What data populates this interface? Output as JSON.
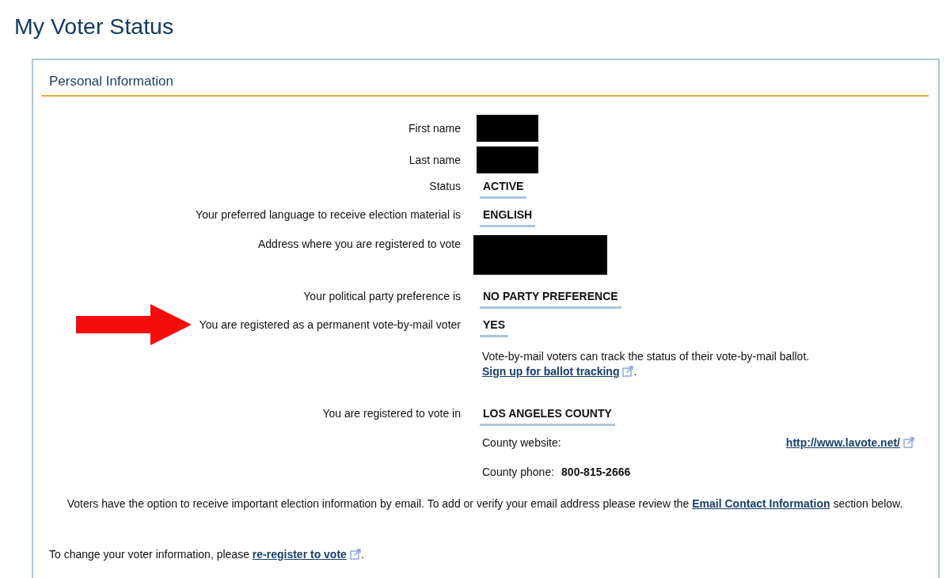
{
  "page_title": "My Voter Status",
  "panel": {
    "title": "Personal Information",
    "rows": [
      {
        "label": "First name",
        "kind": "redacted-name",
        "highlighted": false
      },
      {
        "label": "Last name",
        "kind": "redacted-name",
        "highlighted": false
      },
      {
        "label": "Status",
        "kind": "value",
        "value": "ACTIVE",
        "highlighted": false
      },
      {
        "label": "Your preferred language to receive election material is",
        "kind": "value",
        "value": "ENGLISH",
        "highlighted": false
      },
      {
        "label": "Address where you are registered to vote",
        "kind": "redacted-address",
        "highlighted": false
      },
      {
        "label": "Your political party preference is",
        "kind": "value",
        "value": "NO PARTY PREFERENCE",
        "highlighted": false
      },
      {
        "label": "You are registered as a permanent vote-by-mail voter",
        "kind": "value",
        "value": "YES",
        "highlighted": true,
        "note": {
          "text": "Vote-by-mail voters can track the status of their vote-by-mail ballot.",
          "link": "Sign up for ballot tracking",
          "external": true,
          "after": "."
        }
      },
      {
        "label": "You are registered to vote in",
        "kind": "value",
        "value": "LOS ANGELES COUNTY",
        "highlighted": false,
        "details": [
          {
            "label": "County website:",
            "kind": "link",
            "value": "http://www.lavote.net/",
            "external": true
          },
          {
            "label": "County phone:",
            "kind": "text",
            "value": "800-815-2666"
          }
        ]
      }
    ],
    "email_notice": {
      "before": "Voters have the option to receive important election information by email. To add or verify your email address please review the",
      "link": "Email Contact Information",
      "external": false,
      "after": "section below."
    },
    "change_notice": {
      "before": "To change your voter information, please",
      "link": "re-register to vote",
      "external": true,
      "after": "."
    }
  }
}
